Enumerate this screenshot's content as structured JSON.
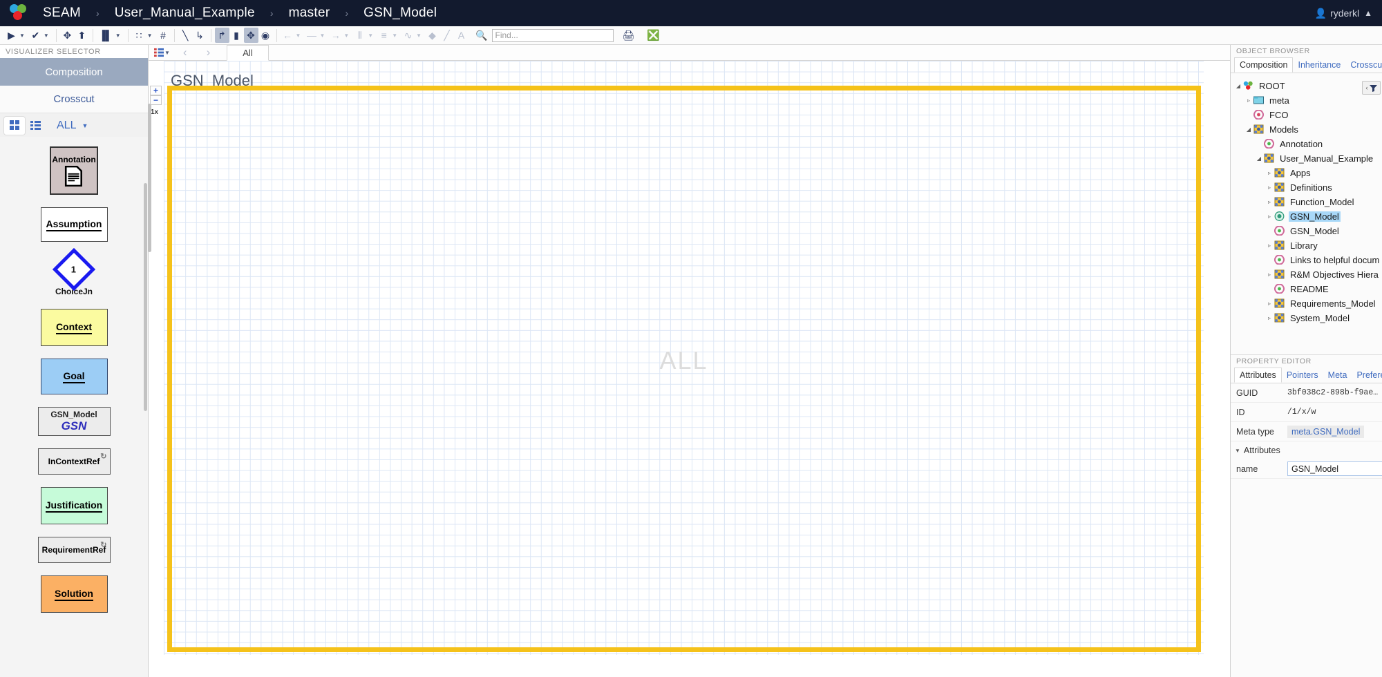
{
  "navbar": {
    "brand": "SEAM",
    "breadcrumbs": [
      "User_Manual_Example",
      "master",
      "GSN_Model"
    ],
    "separator": "›",
    "user": "ryderkl",
    "person_icon": "person-icon",
    "eject_icon": "▲"
  },
  "toolbar": {
    "items": [
      {
        "name": "run-button",
        "glyph": "▶",
        "caret": true
      },
      {
        "name": "check-button",
        "glyph": "✔",
        "caret": true
      },
      {
        "name": "move-tool",
        "glyph": "✥",
        "caret": false
      },
      {
        "name": "autolayout-button",
        "glyph": "⬆",
        "caret": false
      },
      {
        "name": "columns-button",
        "glyph": "▐▌",
        "caret": true
      },
      {
        "name": "grid-button",
        "glyph": "∷",
        "caret": true
      },
      {
        "name": "snap-grid-button",
        "glyph": "#",
        "caret": false
      },
      {
        "name": "line-tool",
        "glyph": "╲",
        "caret": false
      },
      {
        "name": "elbow-connection-tool",
        "glyph": "↳",
        "caret": false
      },
      {
        "name": "routing-tool",
        "glyph": "↱",
        "caret": false,
        "boxed": true
      },
      {
        "name": "lock-button",
        "glyph": "▮",
        "caret": false
      },
      {
        "name": "pan-tool",
        "glyph": "✥",
        "caret": false,
        "boxed": true
      },
      {
        "name": "visibility-button",
        "glyph": "◉",
        "caret": false
      },
      {
        "name": "arrow-start-style",
        "glyph": "←",
        "caret": true,
        "dim": true
      },
      {
        "name": "line-style",
        "glyph": "—",
        "caret": true,
        "dim": true
      },
      {
        "name": "arrow-end-style",
        "glyph": "→",
        "caret": true,
        "dim": true
      },
      {
        "name": "line-width",
        "glyph": "⦀",
        "caret": true,
        "dim": true
      },
      {
        "name": "line-pattern",
        "glyph": "≡",
        "caret": true,
        "dim": true
      },
      {
        "name": "curve-style",
        "glyph": "∿",
        "caret": true,
        "dim": true
      },
      {
        "name": "fill-color",
        "glyph": "◆",
        "caret": false,
        "dim": true
      },
      {
        "name": "line-color",
        "glyph": "╱",
        "caret": false,
        "dim": true
      },
      {
        "name": "text-color",
        "glyph": "A",
        "caret": false,
        "dim": true
      }
    ],
    "find_placeholder": "Find...",
    "find_value": "",
    "search_icon": "search-icon",
    "print_icon": "print-icon",
    "clear_icon": "clear-icon"
  },
  "left_panel": {
    "title": "VISUALIZER SELECTOR",
    "visualizers": [
      {
        "label": "Composition",
        "active": true
      },
      {
        "label": "Crosscut",
        "active": false
      }
    ],
    "palette_filter": "ALL",
    "grid_view_icon": "grid-view-icon",
    "list_view_icon": "list-view-icon",
    "items": [
      {
        "label": "Annotation",
        "style": "annotation",
        "sublabel": "",
        "badge": ""
      },
      {
        "label": "Assumption",
        "style": "plain",
        "sublabel": "",
        "badge": ""
      },
      {
        "label": "ChoiceJn",
        "style": "diamond",
        "sublabel": "1",
        "badge": ""
      },
      {
        "label": "Context",
        "style": "ctx",
        "sublabel": "",
        "badge": ""
      },
      {
        "label": "Goal",
        "style": "goal",
        "sublabel": "",
        "badge": ""
      },
      {
        "label": "GSN_Model",
        "style": "gray",
        "sublabel": "GSN",
        "badge": ""
      },
      {
        "label": "InContextRef",
        "style": "ref",
        "sublabel": "",
        "badge": "↻"
      },
      {
        "label": "Justification",
        "style": "just",
        "sublabel": "",
        "badge": ""
      },
      {
        "label": "RequirementRef",
        "style": "ref",
        "sublabel": "",
        "badge": "↻"
      },
      {
        "label": "Solution",
        "style": "sol",
        "sublabel": "",
        "badge": ""
      }
    ]
  },
  "center": {
    "list_icon": "list-icon",
    "prev_label": "‹",
    "next_label": "›",
    "tabs": [
      {
        "label": "All",
        "active": true
      }
    ],
    "canvas_title": "GSN_Model",
    "watermark": "ALL",
    "zoom_in": "+",
    "zoom_out": "−",
    "zoom_level": "1x",
    "selection_color": "#f5c21a"
  },
  "right_panel": {
    "object_browser_title": "OBJECT BROWSER",
    "object_browser_tabs": [
      {
        "label": "Composition",
        "selected": true
      },
      {
        "label": "Inheritance",
        "selected": false
      },
      {
        "label": "Crosscut",
        "selected": false
      }
    ],
    "filter_icon": "filter-icon",
    "tree": [
      {
        "label": "ROOT",
        "depth": 0,
        "twisty": "open",
        "icon": "root-icon",
        "selected": false
      },
      {
        "label": "meta",
        "depth": 1,
        "twisty": "closed",
        "icon": "folder-icon",
        "selected": false
      },
      {
        "label": "FCO",
        "depth": 1,
        "twisty": "none",
        "icon": "fco-icon",
        "selected": false
      },
      {
        "label": "Models",
        "depth": 1,
        "twisty": "open",
        "icon": "model-icon",
        "selected": false
      },
      {
        "label": "Annotation",
        "depth": 2,
        "twisty": "none",
        "icon": "fco-green-icon",
        "selected": false
      },
      {
        "label": "User_Manual_Example",
        "depth": 2,
        "twisty": "open",
        "icon": "model-icon",
        "selected": false
      },
      {
        "label": "Apps",
        "depth": 3,
        "twisty": "closed",
        "icon": "model-icon",
        "selected": false
      },
      {
        "label": "Definitions",
        "depth": 3,
        "twisty": "closed",
        "icon": "model-icon",
        "selected": false
      },
      {
        "label": "Function_Model",
        "depth": 3,
        "twisty": "closed",
        "icon": "model-icon",
        "selected": false
      },
      {
        "label": "GSN_Model",
        "depth": 3,
        "twisty": "closed",
        "icon": "gsn-icon",
        "selected": true
      },
      {
        "label": "GSN_Model",
        "depth": 3,
        "twisty": "none",
        "icon": "fco-pink-icon",
        "selected": false
      },
      {
        "label": "Library",
        "depth": 3,
        "twisty": "closed",
        "icon": "model-icon",
        "selected": false
      },
      {
        "label": "Links to helpful docum",
        "depth": 3,
        "twisty": "none",
        "icon": "fco-green-icon",
        "selected": false
      },
      {
        "label": "R&M Objectives Hiera",
        "depth": 3,
        "twisty": "closed",
        "icon": "model-icon",
        "selected": false
      },
      {
        "label": "README",
        "depth": 3,
        "twisty": "none",
        "icon": "fco-green-icon",
        "selected": false
      },
      {
        "label": "Requirements_Model",
        "depth": 3,
        "twisty": "closed",
        "icon": "model-icon",
        "selected": false
      },
      {
        "label": "System_Model",
        "depth": 3,
        "twisty": "closed",
        "icon": "model-icon",
        "selected": false
      }
    ],
    "property_editor_title": "PROPERTY EDITOR",
    "property_tabs": [
      {
        "label": "Attributes",
        "selected": true
      },
      {
        "label": "Pointers",
        "selected": false
      },
      {
        "label": "Meta",
        "selected": false
      },
      {
        "label": "Preferences",
        "selected": false
      }
    ],
    "properties": [
      {
        "key": "GUID",
        "value": "3bf038c2-898b-f9ae…",
        "type": "mono"
      },
      {
        "key": "ID",
        "value": "/1/x/w",
        "type": "mono"
      },
      {
        "key": "Meta type",
        "value": "meta.GSN_Model",
        "type": "link"
      }
    ],
    "attributes_section": "Attributes",
    "attributes": [
      {
        "key": "name",
        "value": "GSN_Model"
      }
    ]
  }
}
